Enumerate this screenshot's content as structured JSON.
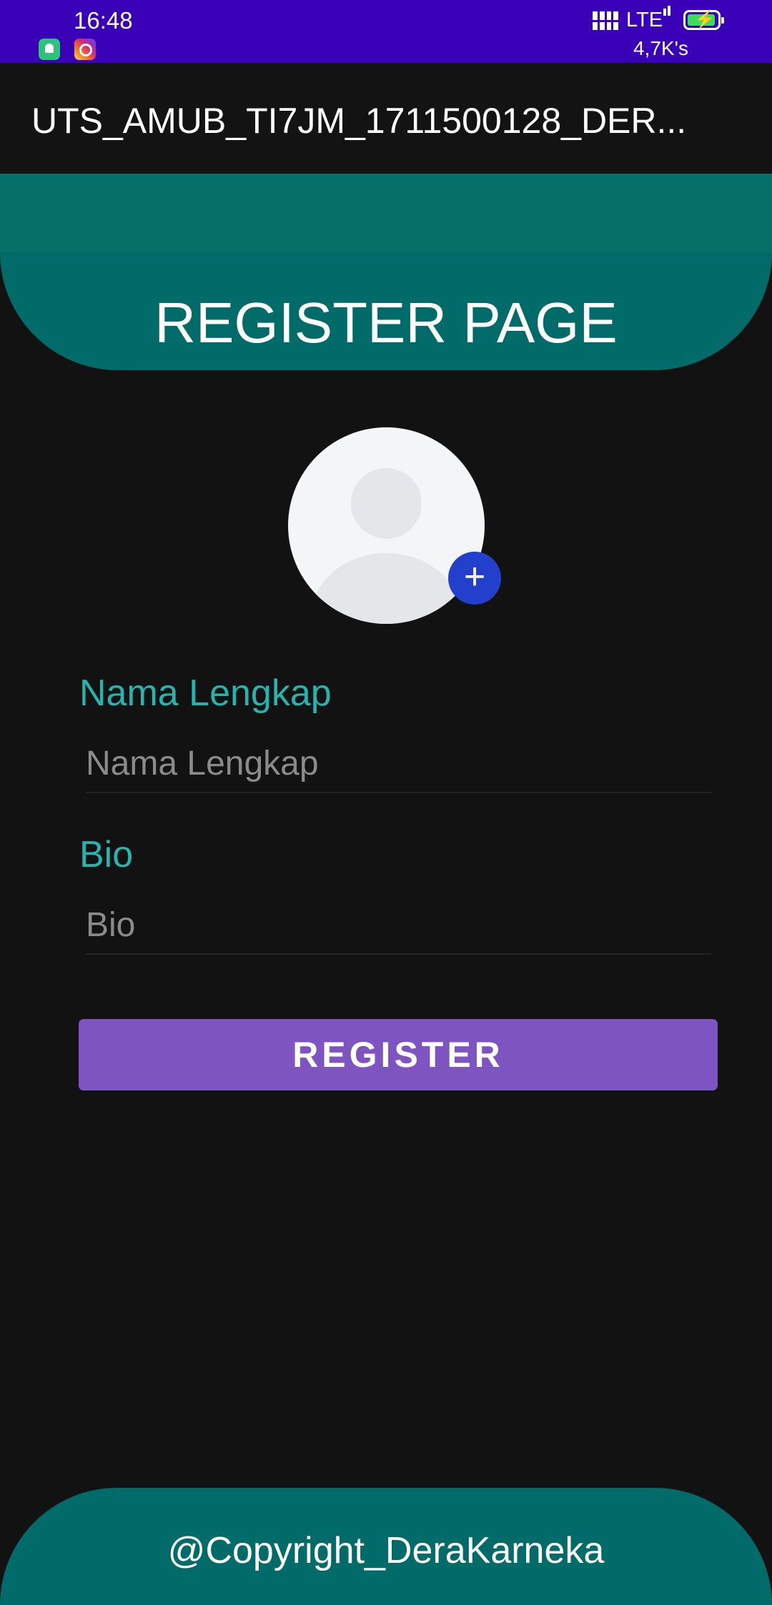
{
  "status_bar": {
    "time": "16:48",
    "network_type": "LTE",
    "net_speed": "4,7K's",
    "notification_icons": [
      "notification-bell-icon",
      "instagram-icon"
    ],
    "battery_color": "#3ddc5b"
  },
  "app_bar": {
    "title": "UTS_AMUB_TI7JM_1711500128_DER..."
  },
  "header": {
    "title": "REGISTER PAGE",
    "color": "#006b68"
  },
  "avatar": {
    "add_icon": "+"
  },
  "form": {
    "name_label": "Nama Lengkap",
    "name_placeholder": "Nama Lengkap",
    "bio_label": "Bio",
    "bio_placeholder": "Bio",
    "label_color": "#26b4ad"
  },
  "register_button": {
    "label": "REGISTER",
    "color": "#7e55c0"
  },
  "footer": {
    "text": "@Copyright_DeraKarneka"
  }
}
